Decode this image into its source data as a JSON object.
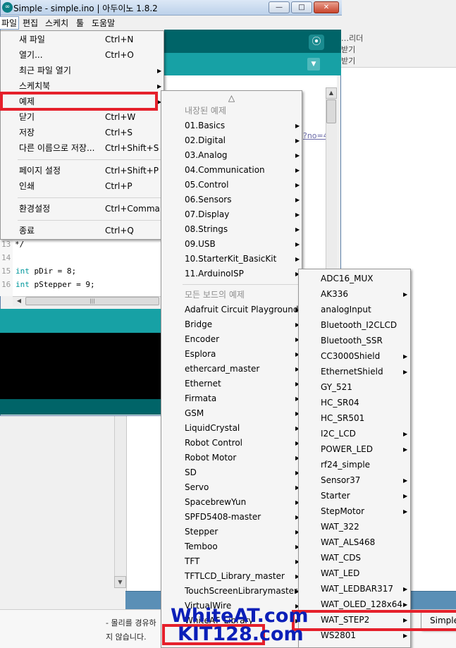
{
  "window": {
    "title": "Simple - simple.ino | 아두이노 1.8.2",
    "buttons": {
      "minimize": "—",
      "maximize": "□",
      "close": "✕"
    }
  },
  "menubar": [
    "파일",
    "편집",
    "스케치",
    "툴",
    "도움말"
  ],
  "toolbar": {
    "serial_icon": "serial-monitor-icon",
    "tab_dropdown_icon": "chevron-down-icon"
  },
  "background": {
    "side_text": [
      "…리더",
      "받기",
      "받기"
    ],
    "link_fragment": "?no=4",
    "bottom_notes": [
      "- 몰리를 경유하",
      "지 않습니다."
    ]
  },
  "editor": {
    "lines": [
      {
        "num": "13",
        "code": "*/"
      },
      {
        "num": "14",
        "code": ""
      },
      {
        "num": "15",
        "kw": "int",
        "code": " pDir = 8;"
      },
      {
        "num": "16",
        "kw": "int",
        "code": " pStepper = 9;"
      }
    ]
  },
  "file_menu": [
    {
      "label": "새 파일",
      "shortcut": "Ctrl+N"
    },
    {
      "label": "열기...",
      "shortcut": "Ctrl+O"
    },
    {
      "label": "최근 파일 열기",
      "submenu": true
    },
    {
      "label": "스케치북",
      "submenu": true
    },
    {
      "label": "예제",
      "submenu": true,
      "highlighted": true
    },
    {
      "label": "닫기",
      "shortcut": "Ctrl+W"
    },
    {
      "label": "저장",
      "shortcut": "Ctrl+S"
    },
    {
      "label": "다른 이름으로 저장...",
      "shortcut": "Ctrl+Shift+S"
    },
    {
      "label": "페이지 설정",
      "shortcut": "Ctrl+Shift+P"
    },
    {
      "label": "인쇄",
      "shortcut": "Ctrl+P"
    },
    {
      "label": "환경설정",
      "shortcut": "Ctrl+Comma"
    },
    {
      "label": "종료",
      "shortcut": "Ctrl+Q"
    }
  ],
  "examples_menu": {
    "scroll_up": "△",
    "builtin_header": "내장된 예제",
    "builtin": [
      "01.Basics",
      "02.Digital",
      "03.Analog",
      "04.Communication",
      "05.Control",
      "06.Sensors",
      "07.Display",
      "08.Strings",
      "09.USB",
      "10.StarterKit_BasicKit",
      "11.ArduinoISP"
    ],
    "all_boards_header": "모든 보드의 예제",
    "all_boards": [
      "Adafruit Circuit Playground",
      "Bridge",
      "Encoder",
      "Esplora",
      "ethercard_master",
      "Ethernet",
      "Firmata",
      "GSM",
      "LiquidCrystal",
      "Robot Control",
      "Robot Motor",
      "SD",
      "Servo",
      "SpacebrewYun",
      "SPFD5408-master",
      "Stepper",
      "Temboo",
      "TFT",
      "TFTLCD_Library_master",
      "TouchScreenLibrarymaster",
      "VirtualWire",
      "WhiteAT_Library"
    ]
  },
  "library_menu": [
    {
      "label": "ADC16_MUX",
      "submenu": false
    },
    {
      "label": "AK336",
      "submenu": true
    },
    {
      "label": "analogInput",
      "submenu": false
    },
    {
      "label": "Bluetooth_I2CLCD",
      "submenu": false
    },
    {
      "label": "Bluetooth_SSR",
      "submenu": false
    },
    {
      "label": "CC3000Shield",
      "submenu": true
    },
    {
      "label": "EthernetShield",
      "submenu": true
    },
    {
      "label": "GY_521",
      "submenu": false
    },
    {
      "label": "HC_SR04",
      "submenu": false
    },
    {
      "label": "HC_SR501",
      "submenu": false
    },
    {
      "label": "I2C_LCD",
      "submenu": true
    },
    {
      "label": "POWER_LED",
      "submenu": true
    },
    {
      "label": "rf24_simple",
      "submenu": false
    },
    {
      "label": "Sensor37",
      "submenu": true
    },
    {
      "label": "Starter",
      "submenu": true
    },
    {
      "label": "StepMotor",
      "submenu": true
    },
    {
      "label": "WAT_322",
      "submenu": false
    },
    {
      "label": "WAT_ALS468",
      "submenu": false
    },
    {
      "label": "WAT_CDS",
      "submenu": false
    },
    {
      "label": "WAT_LED",
      "submenu": false
    },
    {
      "label": "WAT_LEDBAR317",
      "submenu": true
    },
    {
      "label": "WAT_OLED_128x64",
      "submenu": true
    },
    {
      "label": "WAT_STEP2",
      "submenu": true
    },
    {
      "label": "WS2801",
      "submenu": true
    }
  ],
  "step2_submenu": [
    "Simple"
  ],
  "watermark": {
    "line1": "WhiteAT.com",
    "line2": "KIT128.com"
  },
  "colors": {
    "teal_dark": "#006468",
    "teal": "#17a1a5",
    "highlight_red": "#e5202b",
    "watermark_blue": "#0b1fb8"
  }
}
